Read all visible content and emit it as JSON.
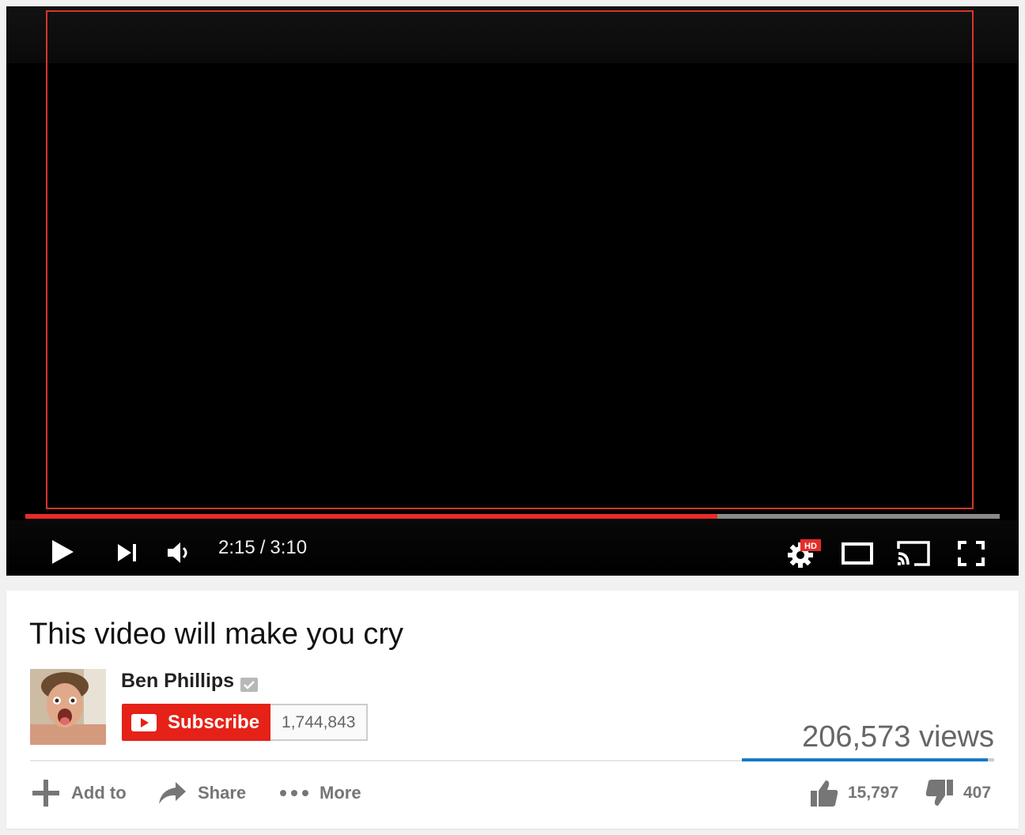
{
  "player": {
    "current_time": "2:15",
    "separator": "/",
    "duration": "3:10",
    "progress_fraction": 0.71,
    "settings_badge": "HD",
    "colors": {
      "progress_played": "#e52d27",
      "progress_track": "#8a8a8a",
      "frame_outline": "#d9342b"
    },
    "icons": {
      "play": "play-icon",
      "next": "next-icon",
      "volume": "volume-icon",
      "settings": "gear-icon",
      "theater": "theater-mode-icon",
      "cast": "cast-icon",
      "fullscreen": "fullscreen-icon"
    }
  },
  "video": {
    "title": "This video will make you cry",
    "views": "206,573 views"
  },
  "channel": {
    "name": "Ben Phillips",
    "subscribe_label": "Subscribe",
    "subscriber_count": "1,744,843",
    "colors": {
      "subscribe_bg": "#e62117"
    }
  },
  "actions": {
    "add_to": "Add to",
    "share": "Share",
    "more": "More"
  },
  "rating": {
    "likes": "15,797",
    "dislikes": "407",
    "like_fraction": 0.975,
    "colors": {
      "likes_bar": "#167ac6",
      "dislikes_bar": "#cccccc"
    }
  }
}
